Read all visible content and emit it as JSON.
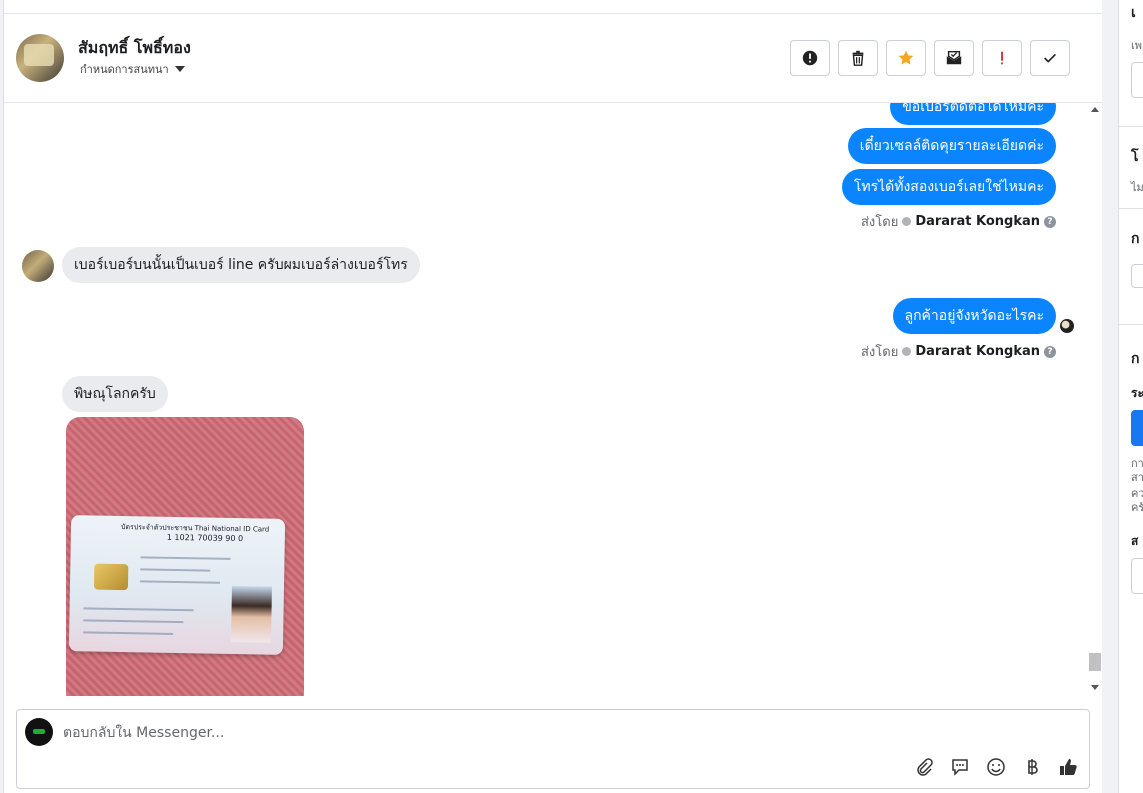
{
  "header": {
    "contact_name": "สัมฤทธิ์ โพธิ์ทอง",
    "contact_subtitle": "กำหนดการสนทนา",
    "actions": [
      {
        "name": "report-spam-button",
        "icon": "alert-circle-icon"
      },
      {
        "name": "delete-button",
        "icon": "trash-icon"
      },
      {
        "name": "star-button",
        "icon": "star-icon"
      },
      {
        "name": "mark-unread-button",
        "icon": "envelope-icon"
      },
      {
        "name": "flag-important-button",
        "icon": "exclamation-icon"
      },
      {
        "name": "mark-done-button",
        "icon": "check-icon"
      }
    ]
  },
  "messages": {
    "out_1": "ขอเบอร์ติดต่อได้ไหมคะ",
    "out_2": "เดี๋ยวเซลล์ติดคุยรายละเอียดค่ะ",
    "out_3": "โทรได้ทั้งสองเบอร์เลยใช่ไหมคะ",
    "sent_by_label": "ส่งโดย",
    "sent_by_name": "Dararat Kongkan",
    "in_1": "เบอร์เบอร์บนนั้นเป็นเบอร์ line ครับผมเบอร์ล่างเบอร์โทร",
    "out_4": "ลูกค้าอยู่จังหวัดอะไรคะ",
    "in_2": "พิษณุโลกครับ"
  },
  "id_card": {
    "header": "บัตรประจำตัวประชาชน Thai National ID Card",
    "number": "1 1021 70039 90 0"
  },
  "composer": {
    "placeholder": "ตอบกลับใน Messenger...",
    "tools": [
      "paperclip-icon",
      "chat-bubble-icon",
      "smiley-icon",
      "baht-icon",
      "thumbs-up-icon"
    ]
  },
  "colors": {
    "outgoing_bubble": "#0b84ff",
    "incoming_bubble": "#e9ebee",
    "star": "#f5a623",
    "important": "#e02020"
  }
}
